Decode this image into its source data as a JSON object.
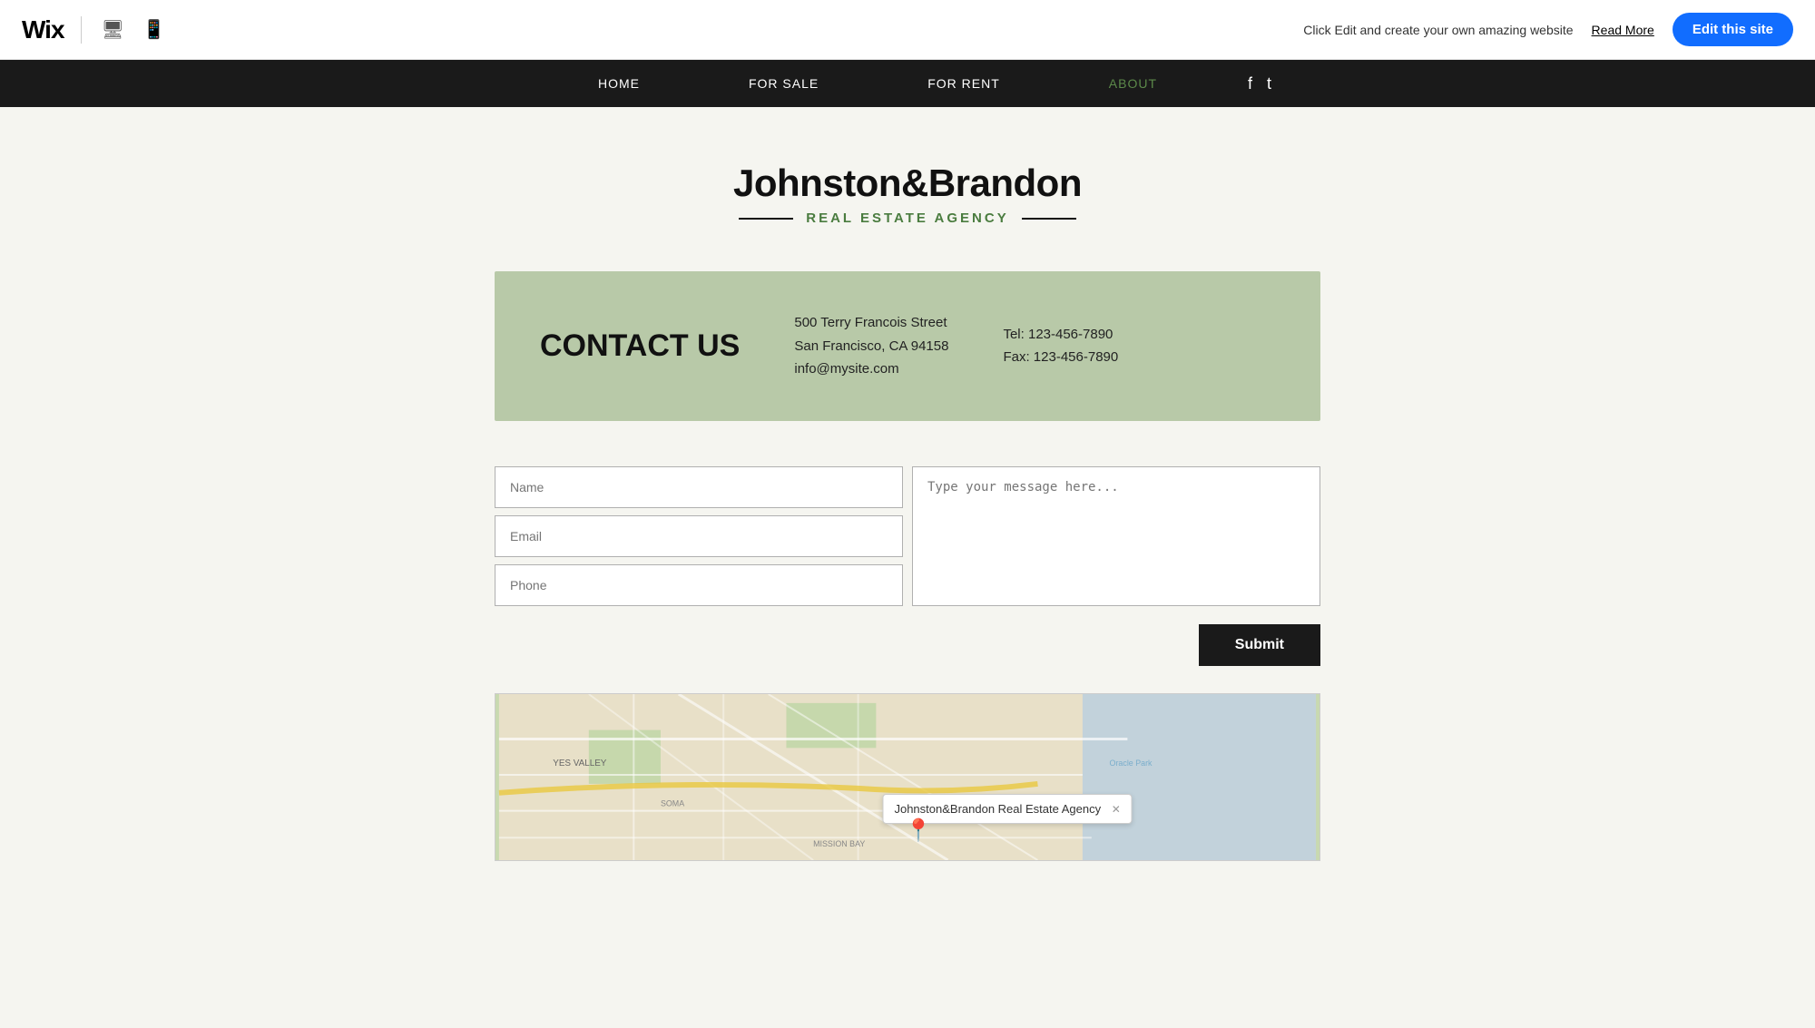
{
  "topbar": {
    "logo": "Wix",
    "promo": "Click Edit and create your own amazing website",
    "read_more": "Read More",
    "edit_btn": "Edit this site"
  },
  "nav": {
    "items": [
      {
        "label": "HOME",
        "active": false
      },
      {
        "label": "FOR SALE",
        "active": false
      },
      {
        "label": "FOR RENT",
        "active": false
      },
      {
        "label": "ABOUT",
        "active": true
      }
    ]
  },
  "brand": {
    "title": "Johnston&Brandon",
    "subtitle": "Real Estate Agency"
  },
  "contact": {
    "heading": "CONTACT US",
    "address_line1": "500 Terry Francois Street",
    "address_line2": "San Francisco, CA  94158",
    "email": "info@mysite.com",
    "tel": "Tel: 123-456-7890",
    "fax": "Fax: 123-456-7890"
  },
  "form": {
    "name_placeholder": "Name",
    "email_placeholder": "Email",
    "phone_placeholder": "Phone",
    "message_placeholder": "Type your message here...",
    "submit_label": "Submit"
  },
  "map": {
    "popup_label": "Johnston&Brandon Real Estate Agency",
    "close_label": "✕"
  }
}
